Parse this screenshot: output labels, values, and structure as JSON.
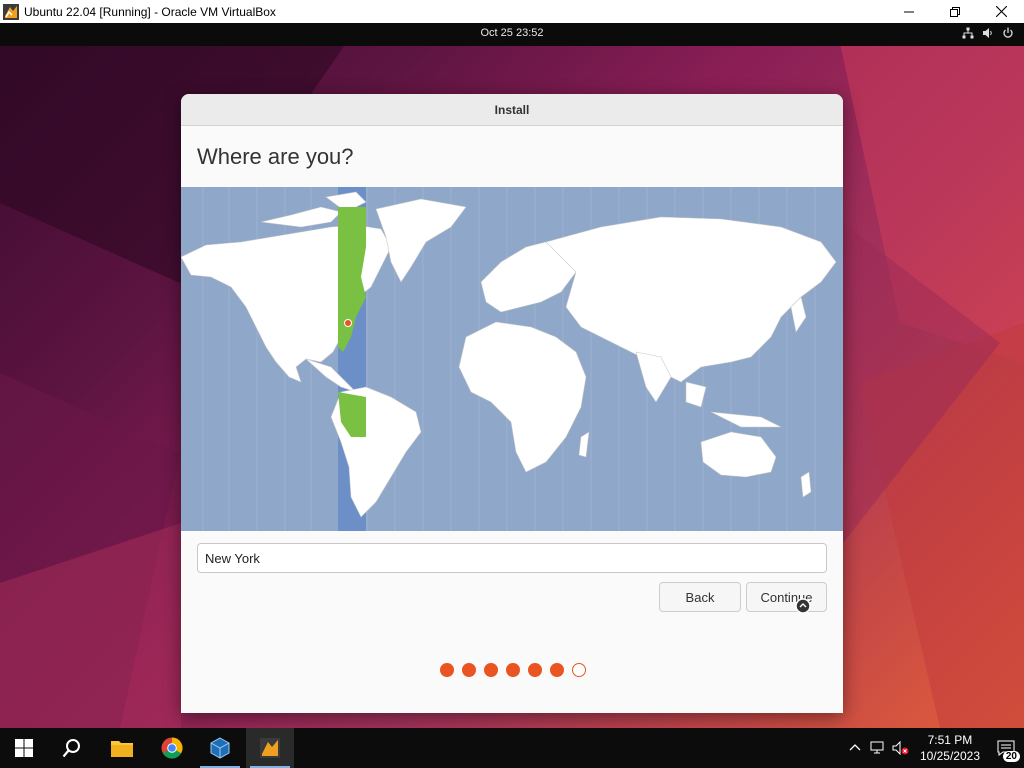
{
  "host_window": {
    "title": "Ubuntu 22.04 [Running] - Oracle VM VirtualBox"
  },
  "gnome_topbar": {
    "clock": "Oct 25  23:52"
  },
  "installer": {
    "window_title": "Install",
    "heading": "Where are you?",
    "timezone_input_value": "New York",
    "back_label": "Back",
    "continue_label": "Continue",
    "progress": {
      "steps_total": 7,
      "steps_done": 6
    }
  },
  "taskbar": {
    "time": "7:51 PM",
    "date": "10/25/2023",
    "notification_count": "20",
    "icons": [
      "windows-start-icon",
      "search-icon",
      "file-explorer-icon",
      "chrome-icon",
      "virtualbox-icon",
      "virtualbox-vm-icon"
    ]
  },
  "colors": {
    "accent": "#e95420",
    "map_water": "#8fa7c9",
    "timezone_highlight": "#7ac143"
  }
}
